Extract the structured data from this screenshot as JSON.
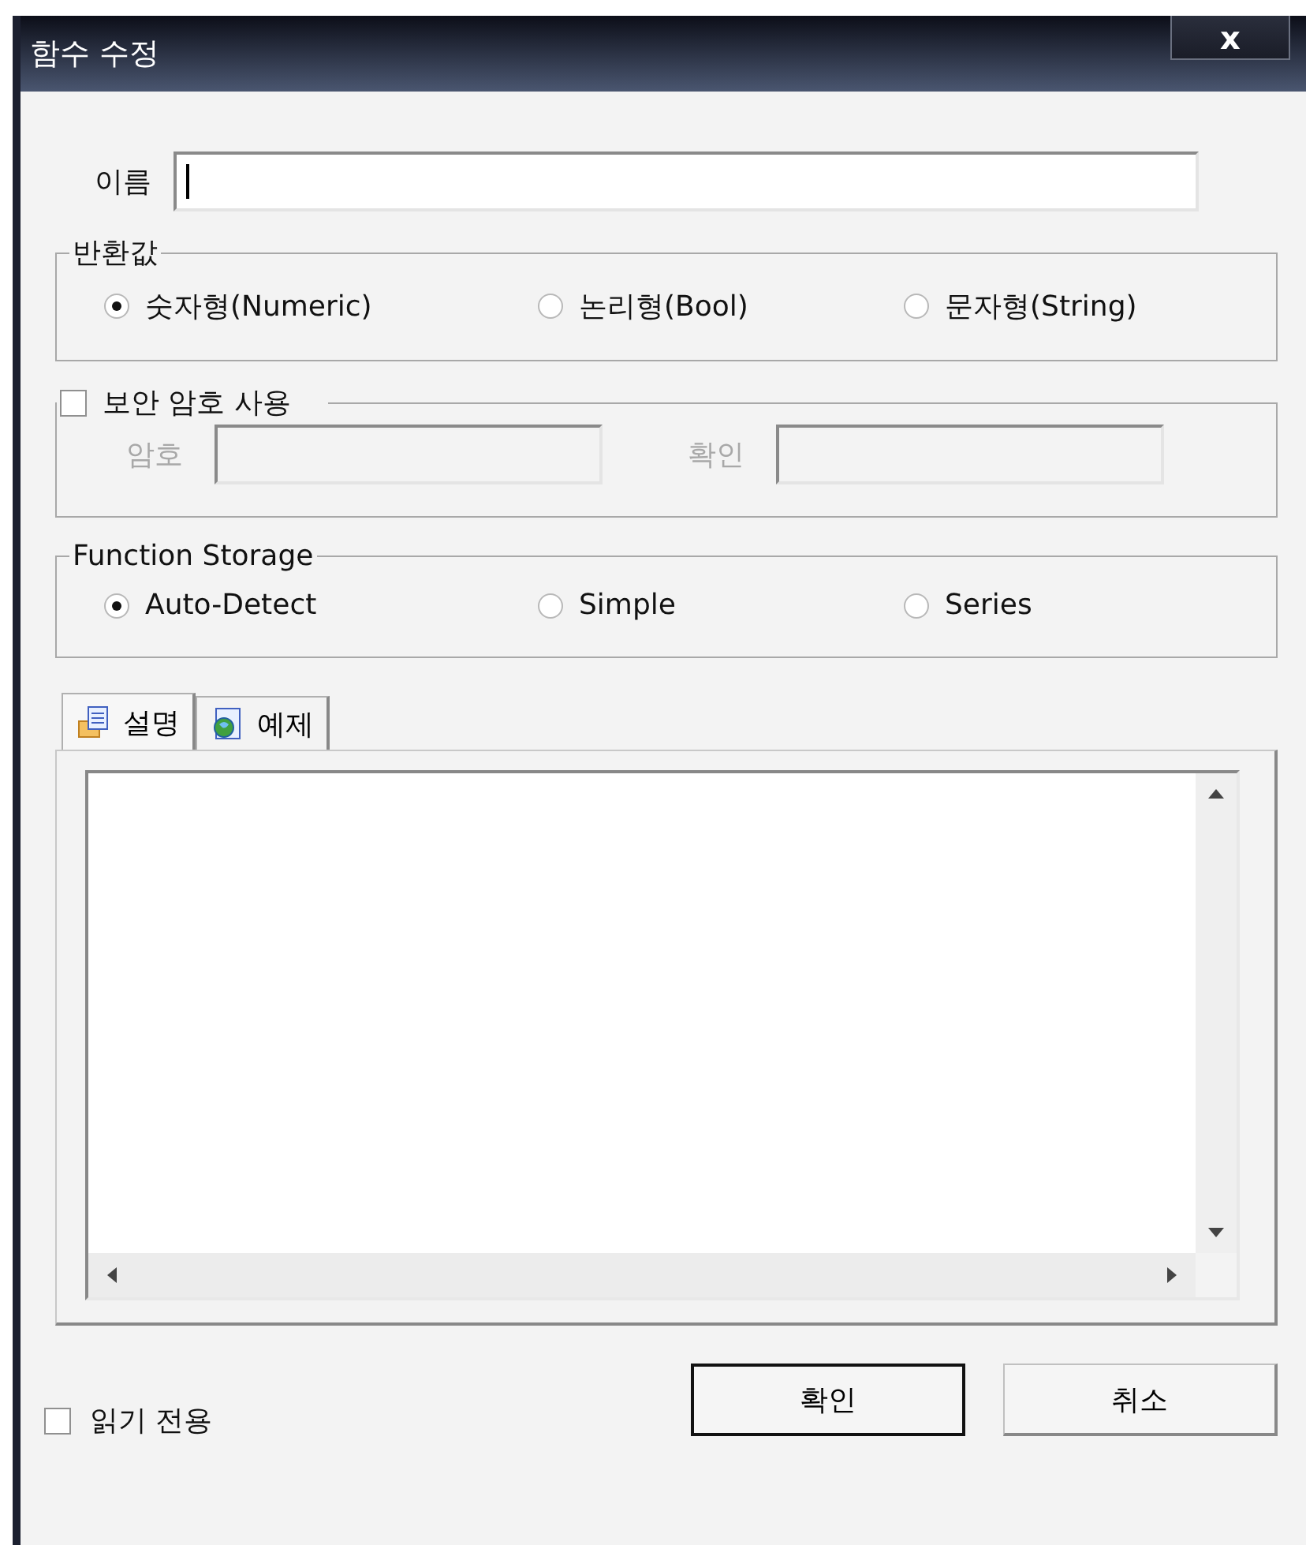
{
  "window": {
    "title": "함수 수정",
    "close_label": "x"
  },
  "name_field": {
    "label": "이름"
  },
  "return_value": {
    "legend": "반환값",
    "options": [
      {
        "label": "숫자형(Numeric)",
        "selected": true
      },
      {
        "label": "논리형(Bool)",
        "selected": false
      },
      {
        "label": "문자형(String)",
        "selected": false
      }
    ]
  },
  "password": {
    "label": "보안 암호 사용",
    "checked": false,
    "fields": [
      {
        "label": "암호",
        "disabled": true
      },
      {
        "label": "확인",
        "disabled": true
      }
    ]
  },
  "function_storage": {
    "legend": "Function Storage",
    "options": [
      {
        "label": "Auto-Detect",
        "selected": true
      },
      {
        "label": "Simple",
        "selected": false
      },
      {
        "label": "Series",
        "selected": false
      }
    ]
  },
  "tabs": [
    {
      "label": "설명",
      "kind": "document",
      "selected": true
    },
    {
      "label": "예제",
      "kind": "globe",
      "selected": false
    }
  ],
  "read_only": {
    "label": "읽기 전용",
    "checked": false
  },
  "buttons": [
    {
      "label": "확인",
      "default": true
    },
    {
      "label": "취소",
      "default": false
    }
  ]
}
